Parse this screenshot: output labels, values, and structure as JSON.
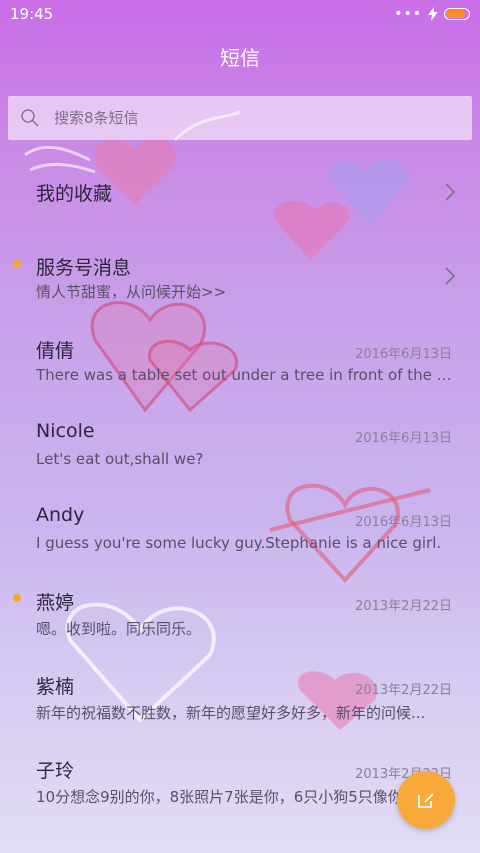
{
  "status": {
    "time": "19:45",
    "dots": "•••",
    "battery_level": 0.85
  },
  "header": {
    "title": "短信"
  },
  "search": {
    "placeholder": "搜索8条短信"
  },
  "favorites": {
    "label": "我的收藏"
  },
  "service": {
    "label": "服务号消息",
    "preview": "情人节甜蜜，从问候开始>>",
    "unread": true
  },
  "conversations": [
    {
      "name": "倩倩",
      "date": "2016年6月13日",
      "preview": "There was a table set out under a tree in front of the ho...",
      "unread": false
    },
    {
      "name": "Nicole",
      "date": "2016年6月13日",
      "preview": "Let's eat out,shall we?",
      "unread": false
    },
    {
      "name": "Andy",
      "date": "2016年6月13日",
      "preview": "I guess you're some lucky guy.Stephanie is a nice girl.",
      "unread": false
    },
    {
      "name": "燕婷",
      "date": "2013年2月22日",
      "preview": "嗯。收到啦。同乐同乐。",
      "unread": true
    },
    {
      "name": "紫楠",
      "date": "2013年2月22日",
      "preview": "新年的祝福数不胜数，新年的愿望好多好多，新年的问候...",
      "unread": false
    },
    {
      "name": "子玲",
      "date": "2013年2月22日",
      "preview": "10分想念9别的你，8张照片7张是你，6只小狗5只像你...",
      "unread": false
    }
  ],
  "colors": {
    "accent": "#f9a83a",
    "unread_dot": "#f5a623"
  },
  "icons": {
    "search": "search-icon",
    "compose": "compose-icon",
    "chevron": "chevron-right-icon",
    "charging": "lightning-icon"
  }
}
